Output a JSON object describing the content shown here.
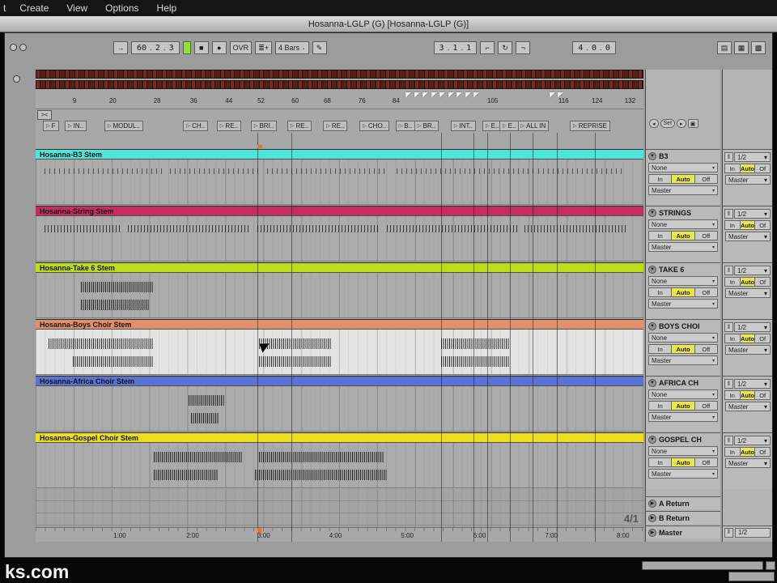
{
  "menu_bar": {
    "items": [
      "t",
      "Create",
      "View",
      "Options",
      "Help"
    ]
  },
  "title_bar": {
    "title": "Hosanna-LGLP (G)  [Hosanna-LGLP (G)]"
  },
  "transport": {
    "follow_icon": "→",
    "tempo": [
      "60",
      "2",
      "3"
    ],
    "dot": ".",
    "stop_icon": "■",
    "record_icon": "●",
    "overdub_label": "OVR",
    "draw_icon": "≣+",
    "quantize_label": "4 Bars",
    "quantize_arrow": "⌄",
    "pencil_icon": "✎",
    "position": [
      "3",
      "1",
      "1"
    ],
    "punch_in_icon": "⌐",
    "loop_icon": "↻",
    "punch_out_icon": "¬",
    "loop_length": [
      "4",
      "0",
      "0"
    ],
    "right_icons": [
      "▤",
      "▦",
      "▩"
    ]
  },
  "zoom_back_label": "><",
  "locator_glyph": "▷",
  "ruler": {
    "bars": [
      {
        "label": "9",
        "pct": 6.1
      },
      {
        "label": "20",
        "pct": 12.1
      },
      {
        "label": "28",
        "pct": 19.4
      },
      {
        "label": "36",
        "pct": 25.4
      },
      {
        "label": "44",
        "pct": 31.2
      },
      {
        "label": "52",
        "pct": 36.5
      },
      {
        "label": "60",
        "pct": 42.1
      },
      {
        "label": "68",
        "pct": 47.4
      },
      {
        "label": "76",
        "pct": 53.1
      },
      {
        "label": "84",
        "pct": 58.7
      },
      {
        "label": "105",
        "pct": 74.3
      },
      {
        "label": "116",
        "pct": 86.0
      },
      {
        "label": "124",
        "pct": 91.5
      },
      {
        "label": "132",
        "pct": 96.9
      }
    ],
    "flags_pct": [
      60.9,
      62.3,
      63.7,
      65.1,
      66.5,
      67.9,
      69.3,
      70.7,
      72.1,
      84.5,
      85.9
    ]
  },
  "locators": [
    {
      "label": "F",
      "pct": 1.2
    },
    {
      "label": "IN..",
      "pct": 4.8
    },
    {
      "label": "MODUL..",
      "pct": 11.3
    },
    {
      "label": "CH..",
      "pct": 24.3
    },
    {
      "label": "RE..",
      "pct": 29.8
    },
    {
      "label": "BRI..",
      "pct": 35.4
    },
    {
      "label": "RE..",
      "pct": 41.4
    },
    {
      "label": "RE..",
      "pct": 47.3
    },
    {
      "label": "CHO..",
      "pct": 53.3
    },
    {
      "label": "B..",
      "pct": 59.2
    },
    {
      "label": "BR..",
      "pct": 62.3
    },
    {
      "label": "INT..",
      "pct": 68.3
    },
    {
      "label": "E..",
      "pct": 73.5
    },
    {
      "label": "E..",
      "pct": 76.3
    },
    {
      "label": "ALL IN",
      "pct": 79.3
    },
    {
      "label": "REPRISE",
      "pct": 87.9
    }
  ],
  "tracks": [
    {
      "name": "Hosanna-B3 Stem",
      "panel_name": "B3",
      "color": "#4ee6da",
      "lane": "#ababab",
      "segments": [
        {
          "x": 1.5,
          "w": 19.3,
          "row": 0,
          "d": "sparse"
        },
        {
          "x": 22.1,
          "w": 14.6,
          "row": 0,
          "d": "sparse"
        },
        {
          "x": 38.1,
          "w": 20.0,
          "row": 0,
          "d": "sparse"
        },
        {
          "x": 59.4,
          "w": 22.6,
          "row": 0,
          "d": "sparse"
        },
        {
          "x": 82.7,
          "w": 14.0,
          "row": 0,
          "d": "sparse"
        }
      ]
    },
    {
      "name": "Hosanna-String Stem",
      "panel_name": "STRINGS",
      "color": "#c22e63",
      "lane": "#ababab",
      "segments": [
        {
          "x": 1.5,
          "w": 12.6,
          "row": 0,
          "d": "mid"
        },
        {
          "x": 15.2,
          "w": 20.2,
          "row": 0,
          "d": "mid"
        },
        {
          "x": 36.5,
          "w": 20.2,
          "row": 0,
          "d": "mid"
        },
        {
          "x": 57.8,
          "w": 21.6,
          "row": 0,
          "d": "mid"
        },
        {
          "x": 80.4,
          "w": 16.9,
          "row": 0,
          "d": "mid"
        }
      ]
    },
    {
      "name": "Hosanna-Take 6 Stem",
      "panel_name": "TAKE 6",
      "color": "#bfdc18",
      "lane": "#ababab",
      "segments": [
        {
          "x": 7.5,
          "w": 12.0,
          "row": 0,
          "d": "dense"
        },
        {
          "x": 7.5,
          "w": 11.2,
          "row": 1,
          "d": "dense"
        }
      ]
    },
    {
      "name": "Hosanna-Boys Choir Stem",
      "panel_name": "BOYS CHOI",
      "color": "#e28f6b",
      "lane": "#e3e3e3",
      "segments": [
        {
          "x": 2.1,
          "w": 17.3,
          "row": 0,
          "d": "dense"
        },
        {
          "x": 36.7,
          "w": 12.0,
          "row": 0,
          "d": "dense"
        },
        {
          "x": 66.7,
          "w": 11.3,
          "row": 0,
          "d": "dense"
        },
        {
          "x": 6.1,
          "w": 13.3,
          "row": 1,
          "d": "dense"
        },
        {
          "x": 36.7,
          "w": 12.0,
          "row": 1,
          "d": "dense"
        },
        {
          "x": 66.7,
          "w": 11.3,
          "row": 1,
          "d": "dense"
        }
      ]
    },
    {
      "name": "Hosanna-Africa Choir Stem",
      "panel_name": "AFRICA CH",
      "color": "#5873d2",
      "lane": "#ababab",
      "segments": [
        {
          "x": 25.2,
          "w": 6.0,
          "row": 0,
          "d": "dense"
        },
        {
          "x": 25.6,
          "w": 4.5,
          "row": 1,
          "d": "dense"
        }
      ]
    },
    {
      "name": "Hosanna-Gospel Choir Stem",
      "panel_name": "GOSPEL CH",
      "color": "#eede1d",
      "lane": "#ababab",
      "segments": [
        {
          "x": 19.4,
          "w": 14.6,
          "row": 0,
          "d": "dense"
        },
        {
          "x": 36.7,
          "w": 20.6,
          "row": 0,
          "d": "dense"
        },
        {
          "x": 19.4,
          "w": 10.6,
          "row": 1,
          "d": "dense"
        },
        {
          "x": 36.1,
          "w": 21.7,
          "row": 1,
          "d": "dense"
        }
      ]
    }
  ],
  "vlines_pct": [
    36.5,
    42.1,
    66.7,
    72.0,
    74.3,
    78.0,
    81.8,
    85.8,
    92.0
  ],
  "insert_marker_pct": 36.5,
  "panel": {
    "fold_icon": "▼",
    "return_fold_icon": "▶",
    "routing_top": "None",
    "monitor": [
      "In",
      "Auto",
      "Off"
    ],
    "monitor_active": "Auto",
    "routing_bottom": "Master",
    "dropdown_arrow": "▾",
    "set_controls": {
      "prev": "◂",
      "set": "Set",
      "next": "▸",
      "lock": "▣"
    },
    "io_icon": "‖",
    "io_meter": "1/2",
    "io_monitor": [
      "In",
      "Auto",
      "Of"
    ],
    "io_routing": "Master"
  },
  "returns": [
    {
      "name": "A Return"
    },
    {
      "name": "B Return"
    },
    {
      "name": "Master",
      "io_meter": "1/2"
    }
  ],
  "time_signature": "4/1",
  "time_ruler": [
    {
      "label": "1:00",
      "pct": 12.8
    },
    {
      "label": "2:00",
      "pct": 24.8
    },
    {
      "label": "3:00",
      "pct": 36.5
    },
    {
      "label": "4:00",
      "pct": 48.3
    },
    {
      "label": "5:00",
      "pct": 60.1
    },
    {
      "label": "6:00",
      "pct": 72.0
    },
    {
      "label": "7:00",
      "pct": 83.8
    },
    {
      "label": "8:00",
      "pct": 95.6
    }
  ],
  "watermark": "ks.com"
}
